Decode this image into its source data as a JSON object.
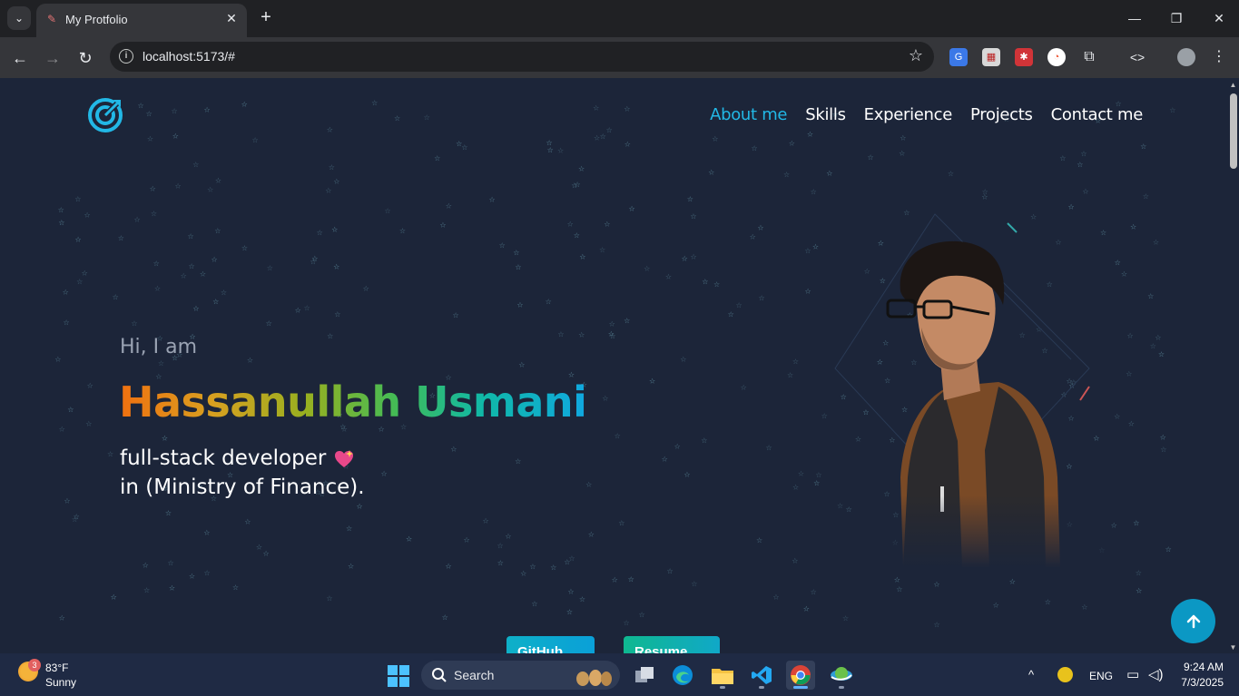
{
  "browser": {
    "tab_title": "My Protfolio",
    "url": "localhost:5173/#"
  },
  "site": {
    "nav": [
      "About me",
      "Skills",
      "Experience",
      "Projects",
      "Contact me"
    ],
    "active_nav": "About me",
    "greeting": "Hi, I am",
    "name": "Hassanullah Usmani",
    "role_line1": "full-stack developer",
    "role_line2": "in (Ministry of Finance).",
    "buttons": {
      "github": "GitHub",
      "resume": "Resume"
    },
    "accent_color": "#22b8e6"
  },
  "taskbar": {
    "weather_badge": "3",
    "weather_temp": "83°F",
    "weather_desc": "Sunny",
    "search_label": "Search",
    "language": "ENG",
    "time": "9:24 AM",
    "date": "7/3/2025"
  },
  "icons": [
    "tab-list-icon",
    "favicon-icon",
    "close-icon",
    "new-tab-icon",
    "minimize-icon",
    "maximize-icon",
    "back-icon",
    "forward-icon",
    "reload-icon",
    "site-info-icon",
    "bookmark-star-icon",
    "extension-icon",
    "devtools-icon",
    "profile-avatar-icon",
    "more-icon",
    "logo-icon",
    "sparkle-heart-icon",
    "arrow-up-icon",
    "windows-start-icon",
    "search-icon",
    "task-view-icon",
    "edge-icon",
    "file-explorer-icon",
    "vscode-icon",
    "chrome-icon",
    "app-icon"
  ]
}
